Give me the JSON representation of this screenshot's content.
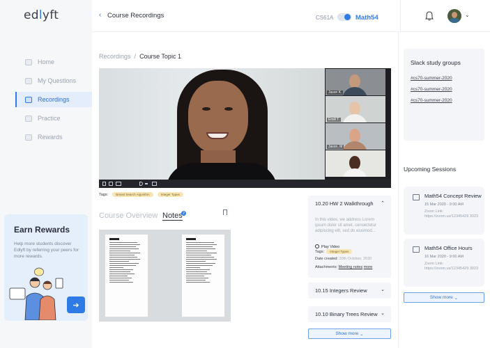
{
  "app": {
    "logo": "edlyft"
  },
  "sidebar": {
    "items": [
      {
        "label": "Home"
      },
      {
        "label": "My Questions"
      },
      {
        "label": "Recordings"
      },
      {
        "label": "Practice"
      },
      {
        "label": "Rewards"
      }
    ],
    "rewards": {
      "title": "Earn Rewards",
      "text": "Help more students discover Edlyft by referring your peers for more rewards."
    }
  },
  "header": {
    "back_label": "Course Recordings",
    "course_a": "CS61A",
    "course_b": "Math54"
  },
  "breadcrumb": {
    "parent": "Recordings",
    "separator": "/",
    "current": "Course Topic 1"
  },
  "video": {
    "participants": [
      "Jason K.",
      "Emili T.",
      "Jason, M",
      ""
    ]
  },
  "tags": {
    "label": "Tags:",
    "items": [
      "Breast Search Algorithm",
      "Integer Types"
    ]
  },
  "tabs": {
    "overview": "Course Overview",
    "notes": "Notes",
    "notes_count": "2"
  },
  "walkthroughs": [
    {
      "title": "10.20 HW 2 Walkthrough",
      "description": "In this video, we address Lorem ipsum dolor sit amet, consectetur adipiscing elit, sed do eiusmod...",
      "play_label": "Play Video",
      "tags_label": "Tags:",
      "tag": "Integer Types",
      "date_label": "Date created:",
      "date": "20th October, 2020",
      "attachments_label": "Attachments:",
      "attachment_1": "Meeting notes",
      "attachment_2": "more"
    },
    {
      "title": "10.15 Integers Review"
    },
    {
      "title": "10.10 Binary Trees Review"
    }
  ],
  "show_more_main": "Show more",
  "slack": {
    "title": "Slack study groups",
    "links": [
      "#cs70-summer-2020",
      "#cs70-summer-2020",
      "#cs70-summer-2020"
    ]
  },
  "upcoming": {
    "title": "Upcoming Sessions",
    "sessions": [
      {
        "title": "Math54 Concept Review",
        "date": "15 Mar 2020 - 9:00 AM",
        "zoom": "Zoom Link: https://zoom.us/12345429 3023"
      },
      {
        "title": "Math54 Office Hours",
        "date": "16 Mar 2020 - 9:00 AM",
        "zoom": "Zoom Link: https://zoom.us/12345429 3023"
      }
    ],
    "show_more": "Show more"
  }
}
